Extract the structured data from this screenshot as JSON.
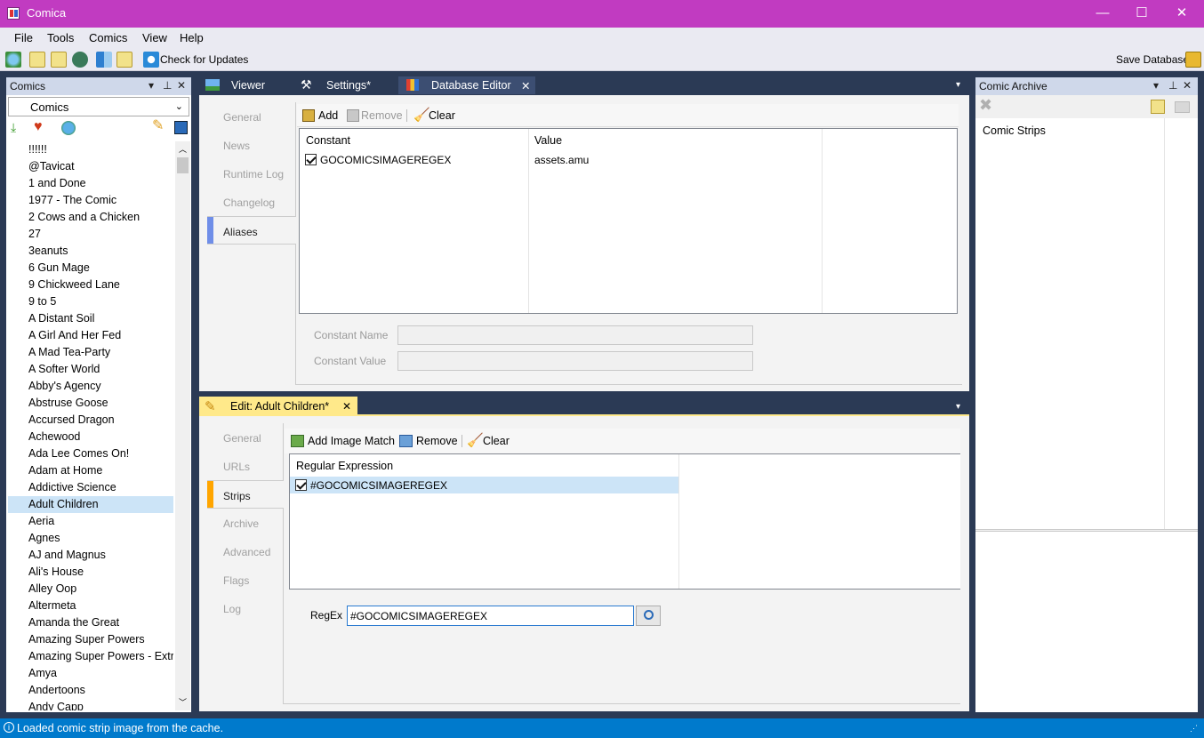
{
  "window": {
    "title": "Comica",
    "minimize": "—",
    "maximize": "☐",
    "close": "✕"
  },
  "menu": [
    "File",
    "Tools",
    "Comics",
    "View",
    "Help"
  ],
  "toolbar": {
    "check_updates": "Check for Updates",
    "save_db": "Save Database"
  },
  "comics_panel": {
    "title": "Comics",
    "dropdown_value": "Comics",
    "items": [
      "!!!!!!",
      "@Tavicat",
      "1 and Done",
      "1977 - The Comic",
      "2 Cows and a Chicken",
      "27",
      "3eanuts",
      "6 Gun Mage",
      "9 Chickweed Lane",
      "9 to 5",
      "A Distant Soil",
      "A Girl And Her Fed",
      "A Mad Tea-Party",
      "A Softer World",
      "Abby's Agency",
      "Abstruse Goose",
      "Accursed Dragon",
      "Achewood",
      "Ada Lee Comes On!",
      "Adam at Home",
      "Addictive Science",
      "Adult Children",
      "Aeria",
      "Agnes",
      "AJ and Magnus",
      "Ali's House",
      "Alley Oop",
      "Altermeta",
      "Amanda the Great",
      "Amazing Super Powers",
      "Amazing Super Powers - Extra",
      "Amya",
      "Andertoons",
      "Andy Capp"
    ],
    "selected": "Adult Children"
  },
  "top_tabs": {
    "viewer": "Viewer",
    "settings": "Settings*",
    "db_editor": "Database Editor"
  },
  "db_editor": {
    "side_tabs": [
      "General",
      "News",
      "Runtime Log",
      "Changelog",
      "Aliases"
    ],
    "active_side": "Aliases",
    "toolbar": {
      "add": "Add",
      "remove": "Remove",
      "clear": "Clear"
    },
    "columns": {
      "constant": "Constant",
      "value": "Value"
    },
    "row": {
      "constant": "GOCOMICSIMAGEREGEX",
      "value": "assets.amu"
    },
    "constant_name_label": "Constant Name",
    "constant_value_label": "Constant Value"
  },
  "edit_panel": {
    "tab": "Edit: Adult Children*",
    "side_tabs": [
      "General",
      "URLs",
      "Strips",
      "Archive",
      "Advanced",
      "Flags",
      "Log"
    ],
    "active_side": "Strips",
    "toolbar": {
      "add": "Add Image Match",
      "remove": "Remove",
      "clear": "Clear"
    },
    "column": "Regular Expression",
    "row": "#GOCOMICSIMAGEREGEX",
    "regex_label": "RegEx",
    "regex_value": "#GOCOMICSIMAGEREGEX"
  },
  "archive_panel": {
    "title": "Comic Archive",
    "item": "Comic Strips"
  },
  "status": {
    "text": "Loaded comic strip image from the cache."
  },
  "colors": {
    "titlebar": "#c13bc1",
    "accent": "#007acc",
    "selected": "#cce4f7",
    "tab_accent": "#ffc000",
    "side_accent": "#6f8ee8"
  }
}
